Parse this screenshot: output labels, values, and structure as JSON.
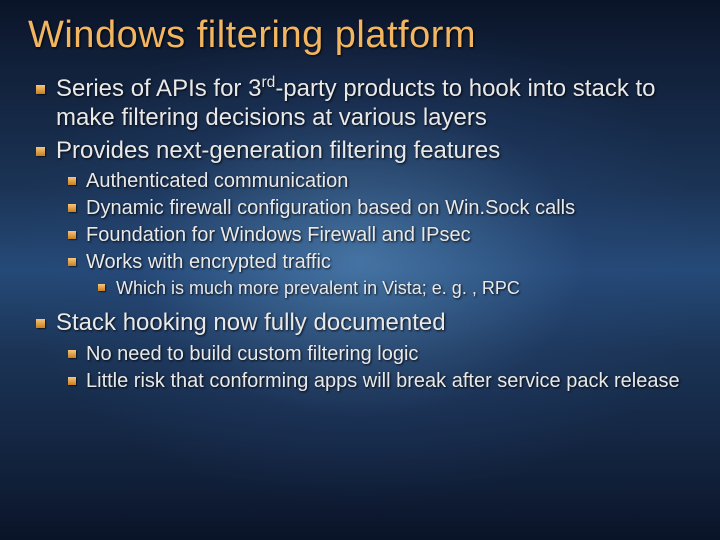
{
  "title": "Windows filtering platform",
  "items": {
    "p1a": "Series of APIs for 3",
    "p1_sup": "rd",
    "p1b": "-party products to hook into stack to make filtering decisions at various layers",
    "p2": "Provides next-generation filtering features",
    "p2_1": "Authenticated communication",
    "p2_2": "Dynamic firewall configuration based on Win.Sock calls",
    "p2_3": "Foundation for Windows Firewall and IPsec",
    "p2_4": "Works with encrypted traffic",
    "p2_4_1": "Which is much more prevalent in Vista; e. g. , RPC",
    "p3": "Stack hooking now fully documented",
    "p3_1": "No need to build custom filtering logic",
    "p3_2": "Little risk that conforming apps will break after service pack release"
  }
}
